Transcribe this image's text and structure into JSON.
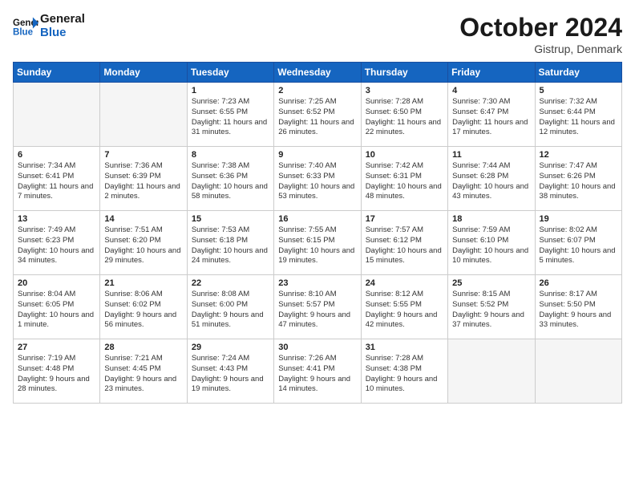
{
  "header": {
    "logo_line1": "General",
    "logo_line2": "Blue",
    "month": "October 2024",
    "location": "Gistrup, Denmark"
  },
  "weekdays": [
    "Sunday",
    "Monday",
    "Tuesday",
    "Wednesday",
    "Thursday",
    "Friday",
    "Saturday"
  ],
  "weeks": [
    [
      {
        "day": "",
        "info": ""
      },
      {
        "day": "",
        "info": ""
      },
      {
        "day": "1",
        "info": "Sunrise: 7:23 AM\nSunset: 6:55 PM\nDaylight: 11 hours and 31 minutes."
      },
      {
        "day": "2",
        "info": "Sunrise: 7:25 AM\nSunset: 6:52 PM\nDaylight: 11 hours and 26 minutes."
      },
      {
        "day": "3",
        "info": "Sunrise: 7:28 AM\nSunset: 6:50 PM\nDaylight: 11 hours and 22 minutes."
      },
      {
        "day": "4",
        "info": "Sunrise: 7:30 AM\nSunset: 6:47 PM\nDaylight: 11 hours and 17 minutes."
      },
      {
        "day": "5",
        "info": "Sunrise: 7:32 AM\nSunset: 6:44 PM\nDaylight: 11 hours and 12 minutes."
      }
    ],
    [
      {
        "day": "6",
        "info": "Sunrise: 7:34 AM\nSunset: 6:41 PM\nDaylight: 11 hours and 7 minutes."
      },
      {
        "day": "7",
        "info": "Sunrise: 7:36 AM\nSunset: 6:39 PM\nDaylight: 11 hours and 2 minutes."
      },
      {
        "day": "8",
        "info": "Sunrise: 7:38 AM\nSunset: 6:36 PM\nDaylight: 10 hours and 58 minutes."
      },
      {
        "day": "9",
        "info": "Sunrise: 7:40 AM\nSunset: 6:33 PM\nDaylight: 10 hours and 53 minutes."
      },
      {
        "day": "10",
        "info": "Sunrise: 7:42 AM\nSunset: 6:31 PM\nDaylight: 10 hours and 48 minutes."
      },
      {
        "day": "11",
        "info": "Sunrise: 7:44 AM\nSunset: 6:28 PM\nDaylight: 10 hours and 43 minutes."
      },
      {
        "day": "12",
        "info": "Sunrise: 7:47 AM\nSunset: 6:26 PM\nDaylight: 10 hours and 38 minutes."
      }
    ],
    [
      {
        "day": "13",
        "info": "Sunrise: 7:49 AM\nSunset: 6:23 PM\nDaylight: 10 hours and 34 minutes."
      },
      {
        "day": "14",
        "info": "Sunrise: 7:51 AM\nSunset: 6:20 PM\nDaylight: 10 hours and 29 minutes."
      },
      {
        "day": "15",
        "info": "Sunrise: 7:53 AM\nSunset: 6:18 PM\nDaylight: 10 hours and 24 minutes."
      },
      {
        "day": "16",
        "info": "Sunrise: 7:55 AM\nSunset: 6:15 PM\nDaylight: 10 hours and 19 minutes."
      },
      {
        "day": "17",
        "info": "Sunrise: 7:57 AM\nSunset: 6:12 PM\nDaylight: 10 hours and 15 minutes."
      },
      {
        "day": "18",
        "info": "Sunrise: 7:59 AM\nSunset: 6:10 PM\nDaylight: 10 hours and 10 minutes."
      },
      {
        "day": "19",
        "info": "Sunrise: 8:02 AM\nSunset: 6:07 PM\nDaylight: 10 hours and 5 minutes."
      }
    ],
    [
      {
        "day": "20",
        "info": "Sunrise: 8:04 AM\nSunset: 6:05 PM\nDaylight: 10 hours and 1 minute."
      },
      {
        "day": "21",
        "info": "Sunrise: 8:06 AM\nSunset: 6:02 PM\nDaylight: 9 hours and 56 minutes."
      },
      {
        "day": "22",
        "info": "Sunrise: 8:08 AM\nSunset: 6:00 PM\nDaylight: 9 hours and 51 minutes."
      },
      {
        "day": "23",
        "info": "Sunrise: 8:10 AM\nSunset: 5:57 PM\nDaylight: 9 hours and 47 minutes."
      },
      {
        "day": "24",
        "info": "Sunrise: 8:12 AM\nSunset: 5:55 PM\nDaylight: 9 hours and 42 minutes."
      },
      {
        "day": "25",
        "info": "Sunrise: 8:15 AM\nSunset: 5:52 PM\nDaylight: 9 hours and 37 minutes."
      },
      {
        "day": "26",
        "info": "Sunrise: 8:17 AM\nSunset: 5:50 PM\nDaylight: 9 hours and 33 minutes."
      }
    ],
    [
      {
        "day": "27",
        "info": "Sunrise: 7:19 AM\nSunset: 4:48 PM\nDaylight: 9 hours and 28 minutes."
      },
      {
        "day": "28",
        "info": "Sunrise: 7:21 AM\nSunset: 4:45 PM\nDaylight: 9 hours and 23 minutes."
      },
      {
        "day": "29",
        "info": "Sunrise: 7:24 AM\nSunset: 4:43 PM\nDaylight: 9 hours and 19 minutes."
      },
      {
        "day": "30",
        "info": "Sunrise: 7:26 AM\nSunset: 4:41 PM\nDaylight: 9 hours and 14 minutes."
      },
      {
        "day": "31",
        "info": "Sunrise: 7:28 AM\nSunset: 4:38 PM\nDaylight: 9 hours and 10 minutes."
      },
      {
        "day": "",
        "info": ""
      },
      {
        "day": "",
        "info": ""
      }
    ]
  ]
}
